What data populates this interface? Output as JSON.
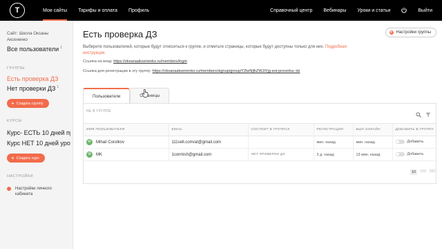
{
  "topbar": {
    "logo": "T",
    "nav": [
      "Мои сайты",
      "Тарифы и оплата",
      "Профиль"
    ],
    "right": [
      "Справочный центр",
      "Вебинары",
      "Уроки и статьи",
      "Выйти"
    ]
  },
  "sidebar": {
    "site_label": "Сайт: Школа Оксаны Аксененко",
    "all_users": "Все пользователи",
    "all_users_count": "1",
    "groups_heading": "ГРУППЫ",
    "groups": [
      {
        "label": "Есть проверка ДЗ",
        "count": ""
      },
      {
        "label": "Нет проверки ДЗ",
        "count": "1"
      }
    ],
    "create_group": "Создать группу",
    "courses_heading": "КУРСЫ",
    "courses": [
      "Курс- ЕСТЬ 10 дней проверка ДЗ",
      "Курс НЕТ 10 дней уроки без проверки"
    ],
    "create_course": "Создать курс",
    "settings_heading": "НАСТРОЙКИ",
    "settings_item": "Настройки личного кабинета"
  },
  "main": {
    "title": "Есть проверка ДЗ",
    "settings_button": "Настройки группы",
    "description": "Выберите пользователей, которые будут относиться к группе, и отметьте страницы, которые будут доступны только для них.",
    "description_link": "Подробная инструкция.",
    "login_label": "Ссылка на вход:",
    "login_url": "https://oksanaaksenenko.ru/members/login",
    "signup_label": "Ссылка для регистрации в эту группу:",
    "signup_url": "https://oksanaaksenenko.ru/members/signup/group/Y2lwNjlhZWJiYjg-est-proverka--dz",
    "tabs": [
      "Пользователи",
      "Страницы"
    ],
    "filter_label": "НЕ В ГРУППЕ",
    "table": {
      "headers": [
        "ИМЯ ПОЛЬЗОВАТЕЛЯ",
        "EMAIL",
        "СОСТОИТ В ГРУППАХ",
        "РЕГИСТРАЦИЯ",
        "БЫЛ ОНЛАЙН",
        "ДОБАВИТЬ В ГРУППУ"
      ],
      "rows": [
        {
          "initial": "M",
          "name": "Mihail Corolkov",
          "email": "111sell.comrat@gmail.com",
          "groups": "",
          "registered": "мин. назад",
          "online": "мин. назад",
          "add": "Добавить"
        },
        {
          "initial": "M",
          "name": "MK",
          "email": "1cormish@gmail.com",
          "groups": "НЕТ ПРОВЕРКИ ДЗ",
          "registered": "3 д. назад",
          "online": "13 мин. назад",
          "add": "Добавить"
        }
      ]
    },
    "pager": [
      "10",
      "100",
      "300"
    ]
  },
  "colors": {
    "accent": "#f26b4b",
    "topbar": "#000000",
    "avatar": "#6db56d"
  }
}
